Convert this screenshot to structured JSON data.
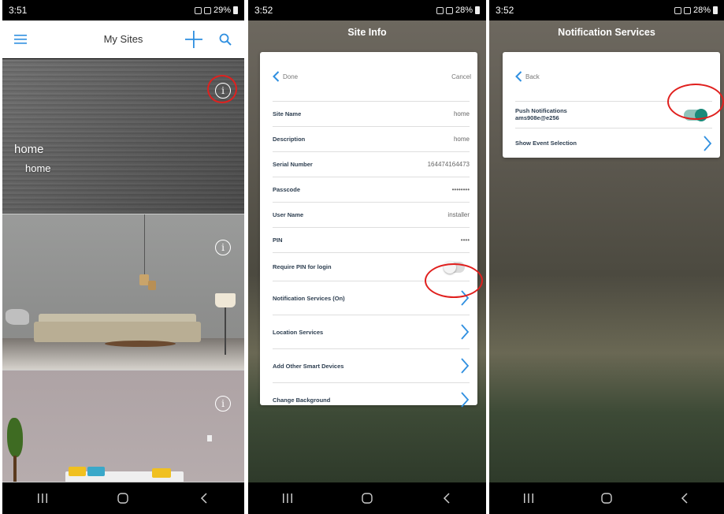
{
  "screens": [
    {
      "status": {
        "time": "3:51",
        "battery": "29%"
      },
      "app_bar": {
        "title": "My Sites",
        "menu_icon": "hamburger-menu-icon",
        "add_icon": "plus-icon",
        "search_icon": "search-icon"
      },
      "sites": [
        {
          "name": "home",
          "description": "home"
        },
        {
          "name": "",
          "description": ""
        },
        {
          "name": "",
          "description": ""
        }
      ]
    },
    {
      "status": {
        "time": "3:52",
        "battery": "28%"
      },
      "title": "Site Info",
      "done_label": "Done",
      "cancel_label": "Cancel",
      "fields": [
        {
          "label": "Site Name",
          "value": "home"
        },
        {
          "label": "Description",
          "value": "home"
        },
        {
          "label": "Serial Number",
          "value": "164474164473"
        },
        {
          "label": "Passcode",
          "value": "••••••••"
        },
        {
          "label": "User Name",
          "value": "installer"
        },
        {
          "label": "PIN",
          "value": "••••"
        }
      ],
      "require_pin": {
        "label": "Require PIN for login",
        "enabled": false
      },
      "links": [
        {
          "label": "Notification Services (On)"
        },
        {
          "label": "Location Services"
        },
        {
          "label": "Add Other Smart Devices"
        },
        {
          "label": "Change Background"
        }
      ]
    },
    {
      "status": {
        "time": "3:52",
        "battery": "28%"
      },
      "title": "Notification Services",
      "back_label": "Back",
      "push": {
        "label": "Push Notifications",
        "account": "ams908e@e256",
        "enabled": true
      },
      "event_selection": {
        "label": "Show Event Selection"
      }
    }
  ],
  "colors": {
    "accent_blue": "#2f8fe0",
    "toggle_on": "#1a8a7a",
    "annotation_red": "#e0201e"
  }
}
